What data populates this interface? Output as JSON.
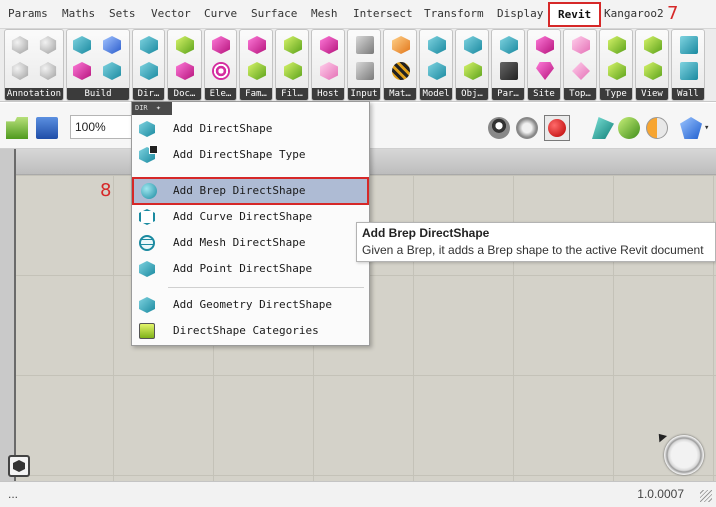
{
  "menu": {
    "items": [
      "Params",
      "Maths",
      "Sets",
      "Vector",
      "Curve",
      "Surface",
      "Mesh",
      "Intersect",
      "Transform",
      "Display",
      "Revit",
      "Kangaroo2"
    ],
    "active": "Revit",
    "step_marker": "7"
  },
  "ribbon": {
    "panels": [
      "Annotation",
      "Build",
      "Dir…",
      "Doc…",
      "Ele…",
      "Fam…",
      "Fil…",
      "Host",
      "Input",
      "Mat…",
      "Model",
      "Obj…",
      "Par…",
      "Site",
      "Top…",
      "Type",
      "View",
      "Wall"
    ]
  },
  "toolbar": {
    "zoom": "100%"
  },
  "dropdown": {
    "header": "DIR",
    "items": [
      {
        "label": "Add DirectShape",
        "icon": "directshape-icon"
      },
      {
        "label": "Add DirectShape Type",
        "icon": "directshape-type-icon"
      },
      {
        "label": "Add Brep DirectShape",
        "icon": "brep-directshape-icon"
      },
      {
        "label": "Add Curve DirectShape",
        "icon": "curve-directshape-icon"
      },
      {
        "label": "Add Mesh DirectShape",
        "icon": "mesh-directshape-icon"
      },
      {
        "label": "Add Point DirectShape",
        "icon": "point-directshape-icon"
      },
      {
        "label": "Add Geometry DirectShape",
        "icon": "geometry-directshape-icon"
      },
      {
        "label": "DirectShape Categories",
        "icon": "directshape-categories-icon"
      }
    ],
    "highlighted": "Add Brep DirectShape",
    "step_marker": "8"
  },
  "tooltip": {
    "title": "Add Brep DirectShape",
    "description": "Given a Brep, it adds a Brep shape to the active Revit document"
  },
  "status": {
    "left": "...",
    "version": "1.0.0007"
  },
  "colors": {
    "accent_red": "#d62828",
    "highlight": "#aebbd4",
    "canvas": "#d4d2c9"
  }
}
